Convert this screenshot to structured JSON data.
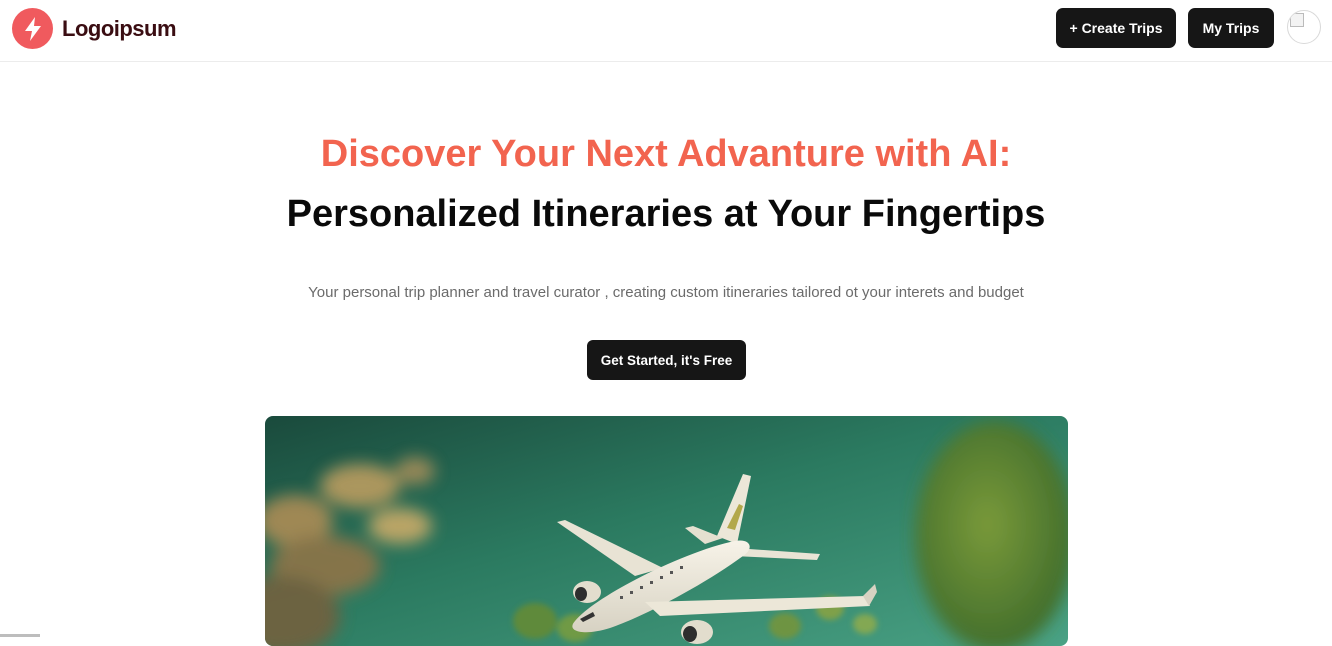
{
  "header": {
    "logo_text": "Logoipsum",
    "logo_icon": "lightning-bolt-icon",
    "create_trips_label": "+ Create Trips",
    "my_trips_label": "My Trips",
    "avatar_icon": "avatar"
  },
  "hero": {
    "title_highlight": "Discover Your Next Advanture with AI:",
    "title_main": "Personalized Itineraries at Your Fingertips",
    "subtitle": "Your personal trip planner and travel curator , creating custom itineraries tailored ot your interets and budget",
    "cta_label": "Get Started, it's Free",
    "image_icon": "airplane-hero-image"
  },
  "colors": {
    "accent": "#f2644f",
    "logo": "#f05a5e",
    "button": "#161616",
    "image_bg": "#2f8466"
  }
}
